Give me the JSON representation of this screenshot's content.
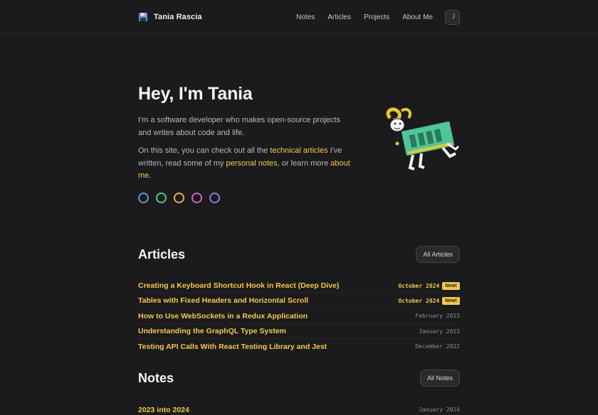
{
  "site": {
    "title": "Tania Rascia",
    "brand_icon": "floppy-disk-icon"
  },
  "nav": {
    "items": [
      {
        "label": "Notes"
      },
      {
        "label": "Articles"
      },
      {
        "label": "Projects"
      },
      {
        "label": "About Me"
      }
    ],
    "theme_toggle_icon": "moon-icon"
  },
  "hero": {
    "heading": "Hey, I'm Tania",
    "intro": "I'm a software developer who makes open-source projects and writes about code and life.",
    "site_text_1": "On this site, you can check out all the ",
    "link_articles": "technical articles",
    "site_text_2": " I've written, read some of my ",
    "link_notes": "personal notes",
    "site_text_3": ", or learn more ",
    "link_about": "about me",
    "site_text_4": ".",
    "theme_colors": [
      "#5b9bd5",
      "#4fc79a",
      "#e8b04a",
      "#d55fc4",
      "#8b7de8"
    ]
  },
  "articles": {
    "heading": "Articles",
    "all_label": "All Articles",
    "posts": [
      {
        "title": "Creating a Keyboard Shortcut Hook in React (Deep Dive)",
        "date": "October 2024",
        "badge": "New!"
      },
      {
        "title": "Tables with Fixed Headers and Horizontal Scroll",
        "date": "October 2024",
        "badge": "New!"
      },
      {
        "title": "How to Use WebSockets in a Redux Application",
        "date": "February 2023"
      },
      {
        "title": "Understanding the GraphQL Type System",
        "date": "January 2023"
      },
      {
        "title": "Testing API Calls With React Testing Library and Jest",
        "date": "December 2022"
      }
    ]
  },
  "notes": {
    "heading": "Notes",
    "all_label": "All Notes",
    "posts": [
      {
        "title": "2023 into 2024",
        "date": "January 2024"
      }
    ]
  },
  "colors": {
    "accent": "#f2c94c",
    "background": "#1b1b1d"
  }
}
